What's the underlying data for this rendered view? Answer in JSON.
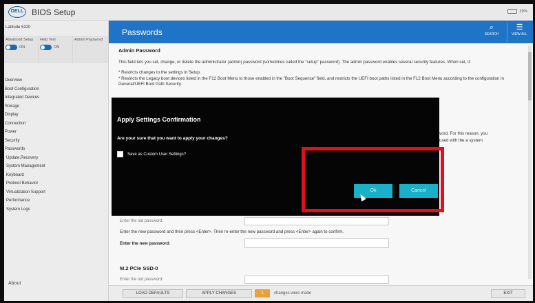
{
  "app": {
    "logo": "DELL",
    "title": "BIOS Setup",
    "battery": "19%"
  },
  "left_panel": {
    "model": "Latitude 5320",
    "toggles": [
      {
        "label": "Advanced Setup",
        "state": "ON"
      },
      {
        "label": "Help Text",
        "state": "ON"
      },
      {
        "label": "Admin Password",
        "state": ""
      }
    ],
    "nav": [
      {
        "label": "Overview"
      },
      {
        "label": "Boot Configuration"
      },
      {
        "label": "Integrated Devices"
      },
      {
        "label": "Storage"
      },
      {
        "label": "Display"
      },
      {
        "label": "Connection"
      },
      {
        "label": "Power"
      },
      {
        "label": "Security"
      },
      {
        "label": "Passwords"
      },
      {
        "label": "Update,Recovery"
      },
      {
        "label": "System Management"
      },
      {
        "label": "Keyboard"
      },
      {
        "label": "Preboot Behavior"
      },
      {
        "label": "Virtualization Support"
      },
      {
        "label": "Performance"
      },
      {
        "label": "System Logs"
      }
    ],
    "about": "About"
  },
  "header": {
    "title": "Passwords",
    "search_label": "SEARCH",
    "view_all_label": "VIEW ALL"
  },
  "content": {
    "section_title": "Admin Password",
    "intro": "This field lets you set, change, or delete the administrator (admin) password (sometimes called the \"setup\" password). The admin password enables several security features. When set, it:",
    "bullet1": "* Restricts changes to the settings in Setup.",
    "bullet2": "* Restricts the Legacy boot devices listed in the F12 Boot Menu to those enabled in the \"Boot Sequence\" field, and restricts the UEFI boot paths listed in the F12 Boot Menu according to the configuration in General/UEFI Boot Path Security.",
    "partial1": "vord. For this reason, you",
    "partial2": "used with the a system",
    "old_pw_label": "Enter the old password:",
    "instruction": "Enter the new password and then press <Enter>. Then re-enter the new password and press <Enter> again to confirm.",
    "new_pw_label": "Enter the new password:",
    "ssd_title": "M.2 PCIe SSD-0",
    "ssd_old_label": "Enter the old password:"
  },
  "bottom": {
    "load_defaults": "LOAD DEFAULTS",
    "apply_changes": "APPLY CHANGES",
    "changes_count": "1",
    "changes_text": "changes were made",
    "exit": "EXIT"
  },
  "dialog": {
    "title": "Apply Settings Confirmation",
    "question": "Are your sure that you want to apply your changes?",
    "checkbox_label": "Save as Custom User Settings?",
    "ok": "Ok",
    "cancel": "Cancel"
  }
}
